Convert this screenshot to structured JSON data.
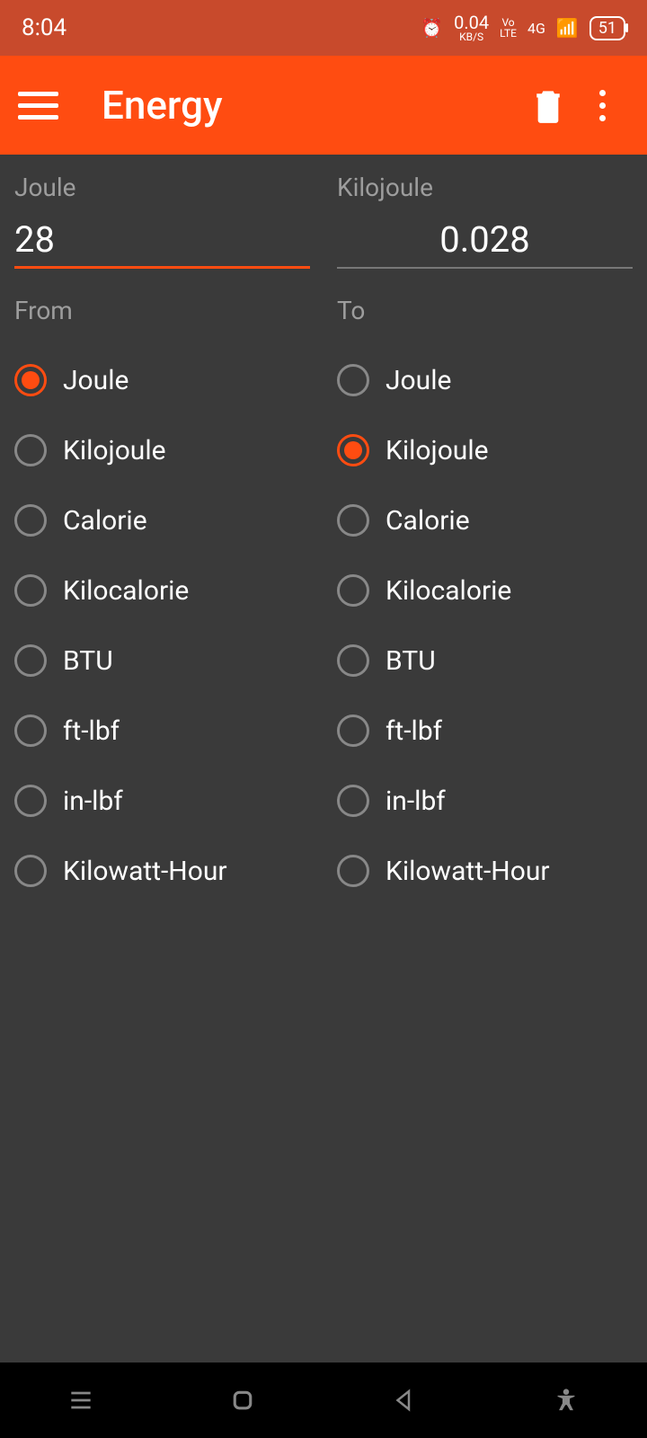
{
  "statusbar": {
    "time": "8:04",
    "speed_value": "0.04",
    "speed_unit": "KB/S",
    "volte": "Vo LTE",
    "network": "4G",
    "battery": "51"
  },
  "appbar": {
    "title": "Energy"
  },
  "left": {
    "unit_label": "Joule",
    "value": "28",
    "section": "From",
    "options": [
      "Joule",
      "Kilojoule",
      "Calorie",
      "Kilocalorie",
      "BTU",
      "ft-lbf",
      "in-lbf",
      "Kilowatt-Hour"
    ],
    "selected_index": 0
  },
  "right": {
    "unit_label": "Kilojoule",
    "value": "0.028",
    "section": "To",
    "options": [
      "Joule",
      "Kilojoule",
      "Calorie",
      "Kilocalorie",
      "BTU",
      "ft-lbf",
      "in-lbf",
      "Kilowatt-Hour"
    ],
    "selected_index": 1
  }
}
